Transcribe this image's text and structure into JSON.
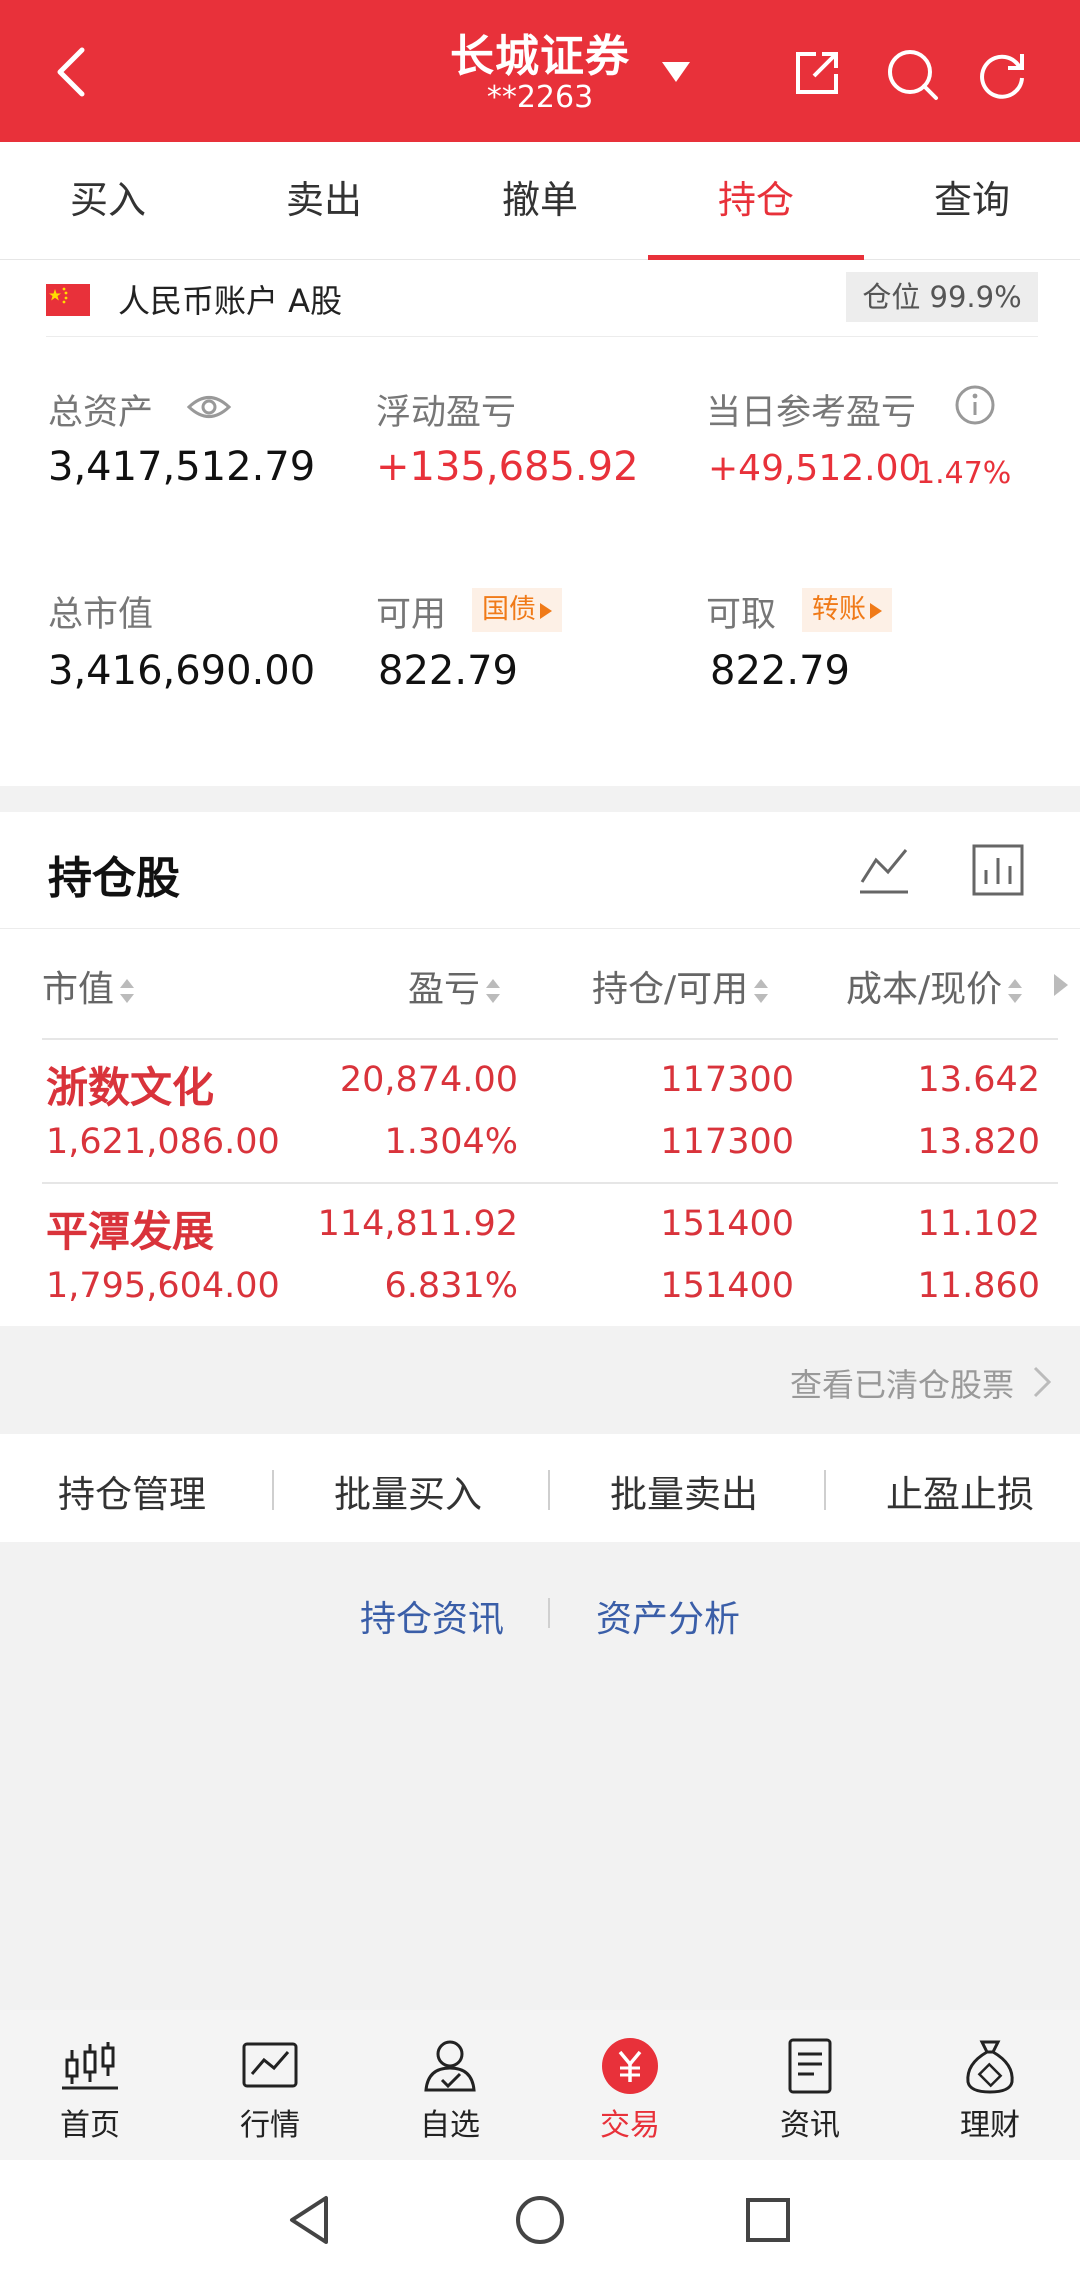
{
  "header": {
    "title": "长城证券",
    "account_masked": "**2263",
    "back_icon": "back-chevron-icon",
    "icons": [
      "share-icon",
      "search-icon",
      "refresh-icon"
    ]
  },
  "tabs": [
    {
      "label": "买入",
      "active": false
    },
    {
      "label": "卖出",
      "active": false
    },
    {
      "label": "撤单",
      "active": false
    },
    {
      "label": "持仓",
      "active": true
    },
    {
      "label": "查询",
      "active": false
    }
  ],
  "account": {
    "type_label": "人民币账户 A股",
    "position_badge": "仓位 99.9%"
  },
  "summary": {
    "total_assets_label": "总资产",
    "total_assets": "3,417,512.79",
    "floating_pl_label": "浮动盈亏",
    "floating_pl": "+135,685.92",
    "daily_pl_label": "当日参考盈亏",
    "daily_pl": "+49,512.00",
    "daily_pl_pct": "1.47%",
    "market_value_label": "总市值",
    "market_value": "3,416,690.00",
    "available_label": "可用",
    "available_tag": "国债",
    "available": "822.79",
    "withdrawable_label": "可取",
    "withdrawable_tag": "转账",
    "withdrawable": "822.79"
  },
  "holdings": {
    "title": "持仓股",
    "columns": [
      "市值",
      "盈亏",
      "持仓/可用",
      "成本/现价"
    ],
    "rows": [
      {
        "name": "浙数文化",
        "market_value": "1,621,086.00",
        "pl": "20,874.00",
        "pl_pct": "1.304%",
        "position": "117300",
        "available": "117300",
        "cost": "13.642",
        "price": "13.820"
      },
      {
        "name": "平潭发展",
        "market_value": "1,795,604.00",
        "pl": "114,811.92",
        "pl_pct": "6.831%",
        "position": "151400",
        "available": "151400",
        "cost": "11.102",
        "price": "11.860"
      }
    ],
    "cleared_link": "查看已清仓股票"
  },
  "actions": [
    "持仓管理",
    "批量买入",
    "批量卖出",
    "止盈止损"
  ],
  "links": [
    "持仓资讯",
    "资产分析"
  ],
  "bottom_nav": [
    {
      "label": "首页",
      "icon": "candlestick-icon",
      "active": false
    },
    {
      "label": "行情",
      "icon": "market-chart-icon",
      "active": false
    },
    {
      "label": "自选",
      "icon": "user-check-icon",
      "active": false
    },
    {
      "label": "交易",
      "icon": "yuan-coin-icon",
      "active": true
    },
    {
      "label": "资讯",
      "icon": "document-icon",
      "active": false
    },
    {
      "label": "理财",
      "icon": "money-bag-icon",
      "active": false
    }
  ],
  "colors": {
    "brand_red": "#e8313a",
    "link_blue": "#3a5ea8",
    "tag_orange": "#f07a18"
  }
}
